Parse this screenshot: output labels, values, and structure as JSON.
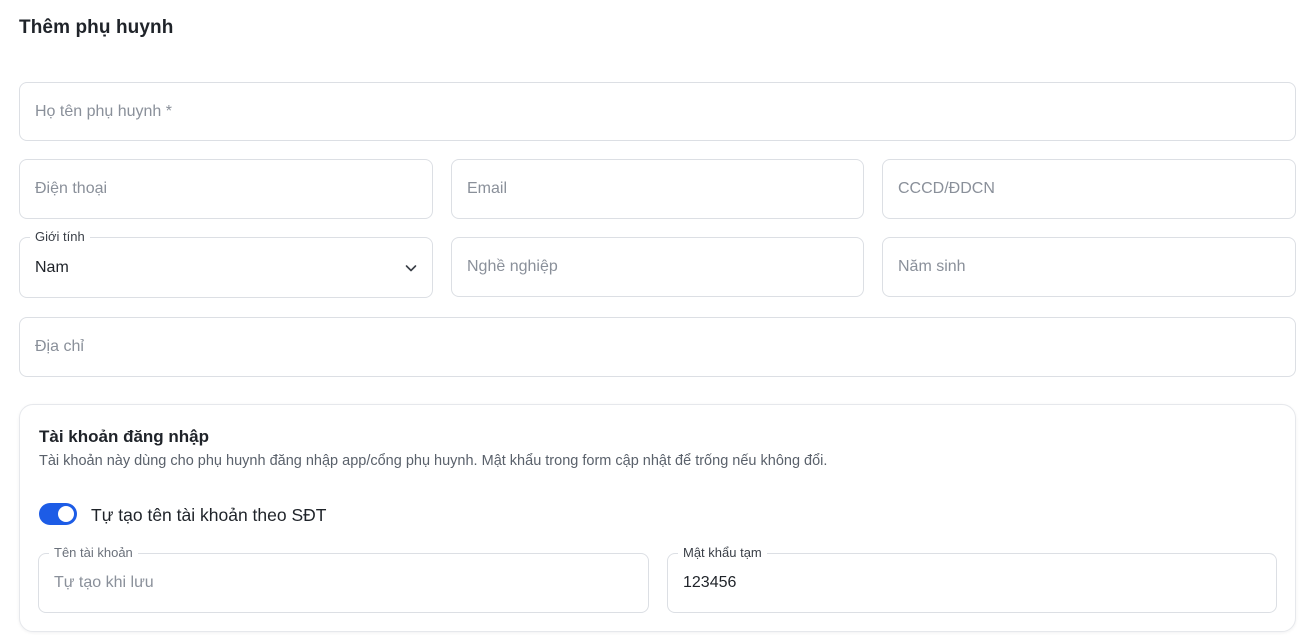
{
  "page": {
    "title": "Thêm phụ huynh"
  },
  "form": {
    "full_name": {
      "placeholder": "Họ tên phụ huynh *",
      "value": ""
    },
    "phone": {
      "placeholder": "Điện thoại",
      "value": ""
    },
    "email": {
      "placeholder": "Email",
      "value": ""
    },
    "id_card": {
      "placeholder": "CCCD/ĐDCN",
      "value": ""
    },
    "gender": {
      "label": "Giới tính",
      "value": "Nam"
    },
    "occupation": {
      "placeholder": "Nghề nghiệp",
      "value": ""
    },
    "birth_year": {
      "placeholder": "Năm sinh",
      "value": ""
    },
    "address": {
      "placeholder": "Địa chỉ",
      "value": ""
    }
  },
  "account": {
    "title": "Tài khoản đăng nhập",
    "description": "Tài khoản này dùng cho phụ huynh đăng nhập app/cổng phụ huynh. Mật khẩu trong form cập nhật để trống nếu không đổi.",
    "auto_username": {
      "label": "Tự tạo tên tài khoản theo SĐT",
      "enabled": true
    },
    "username": {
      "label": "Tên tài khoản",
      "placeholder": "Tự tạo khi lưu",
      "value": ""
    },
    "temp_password": {
      "label": "Mật khẩu tạm",
      "value": "123456"
    }
  },
  "colors": {
    "accent": "#1d5ce6",
    "border": "#dcdfe4",
    "placeholder": "#8a909a"
  },
  "icons": {
    "gender_dropdown": "chevron-down-icon"
  }
}
